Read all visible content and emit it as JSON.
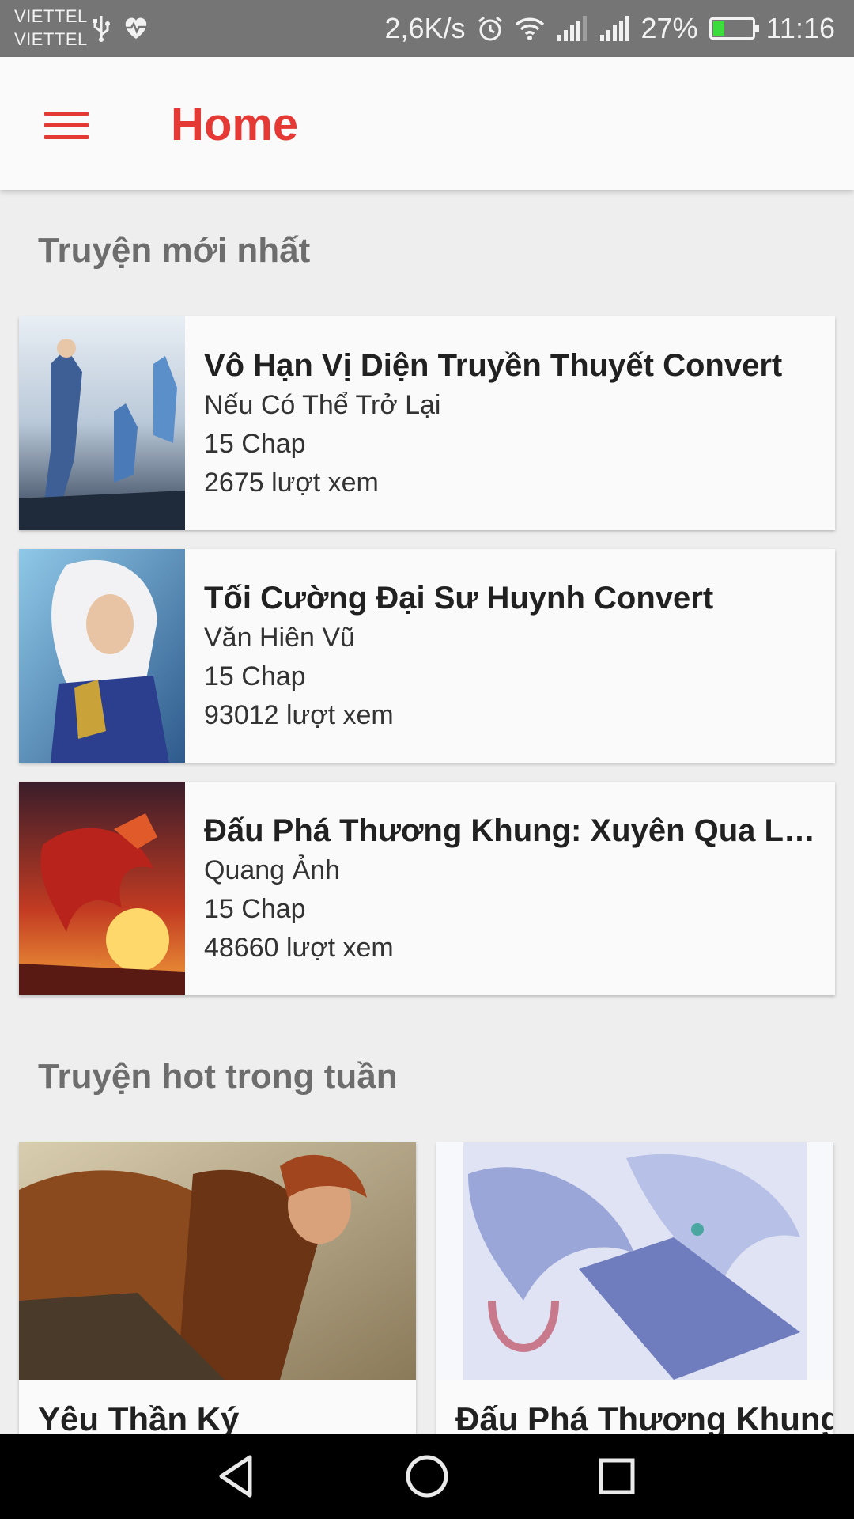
{
  "status_bar": {
    "carrier_1": "VIETTEL",
    "carrier_2": "VIETTEL",
    "speed": "2,6K/s",
    "battery": "27%",
    "time": "11:16",
    "icons": [
      "usb-icon",
      "heart-rate-icon",
      "alarm-icon",
      "wifi-icon",
      "signal-icon",
      "signal-icon",
      "battery-icon"
    ]
  },
  "app_bar": {
    "title": "Home",
    "accent_color": "#e53935"
  },
  "latest": {
    "heading": "Truyện mới nhất",
    "items": [
      {
        "title": "Vô Hạn Vị Diện Truyền Thuyết Convert",
        "author": "Nếu Có Thể Trở Lại",
        "chapters": "15 Chap",
        "views": "2675 lượt xem"
      },
      {
        "title": "Tối Cường Đại Sư Huynh Convert",
        "author": "Văn Hiên Vũ",
        "chapters": "15 Chap",
        "views": "93012 lượt xem"
      },
      {
        "title": "Đấu Phá Thương Khung: Xuyên Qua Lu...",
        "author": "Quang Ảnh",
        "chapters": "15 Chap",
        "views": "48660 lượt xem"
      }
    ]
  },
  "hot": {
    "heading": "Truyện hot trong tuần",
    "items": [
      {
        "title": "Yêu Thần Ký"
      },
      {
        "title": "Đấu Phá Thương Khung"
      }
    ]
  },
  "nav_bar": {
    "icons": [
      "back-icon",
      "home-icon",
      "recents-icon"
    ]
  }
}
